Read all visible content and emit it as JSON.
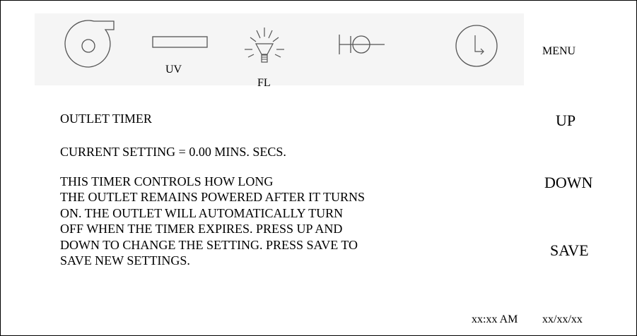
{
  "icon_bar": {
    "fan_icon": "fan-blower-icon",
    "uv_icon": "uv-lamp-icon",
    "uv_label": "UV",
    "fl_icon": "light-bulb-icon",
    "fl_label": "FL",
    "outlet_icon": "outlet-plug-icon",
    "timer_icon": "clock-icon",
    "menu_label": "MENU"
  },
  "screen": {
    "title": "OUTLET TIMER",
    "current_setting": "CURRENT SETTING = 0.00 MINS. SECS.",
    "description": "THIS TIMER CONTROLS HOW LONG\nTHE OUTLET REMAINS POWERED AFTER IT TURNS\nON.  THE OUTLET WILL AUTOMATICALLY TURN\nOFF WHEN THE TIMER EXPIRES.  PRESS UP AND\nDOWN TO CHANGE THE SETTING.  PRESS SAVE TO\nSAVE NEW SETTINGS."
  },
  "side_buttons": {
    "up_label": "UP",
    "down_label": "DOWN",
    "save_label": "SAVE"
  },
  "status_bar": {
    "time": "xx:xx AM",
    "date": "xx/xx/xx"
  }
}
